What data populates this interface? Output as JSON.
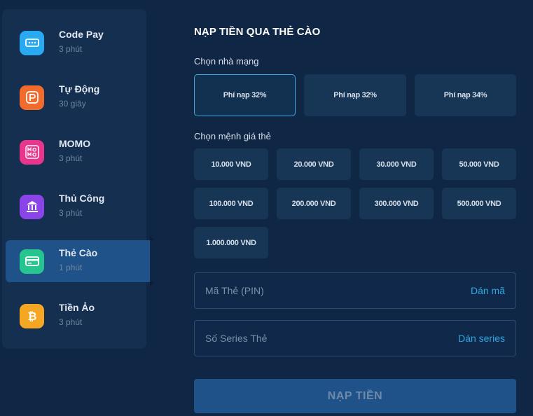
{
  "sidebar": {
    "items": [
      {
        "name": "Code Pay",
        "time": "3 phút",
        "icon": "dots-icon",
        "color": "#29a9f2"
      },
      {
        "name": "Tự Động",
        "time": "30 giây",
        "icon": "p-logo-icon",
        "color": "#f26b2c"
      },
      {
        "name": "MOMO",
        "time": "3 phút",
        "icon": "momo-icon",
        "color": "#e9368c"
      },
      {
        "name": "Thủ Công",
        "time": "3 phút",
        "icon": "bank-icon",
        "color": "#8b44e8"
      },
      {
        "name": "Thẻ Cào",
        "time": "1 phút",
        "icon": "card-icon",
        "color": "#26c48f"
      },
      {
        "name": "Tiền Ảo",
        "time": "3 phút",
        "icon": "bitcoin-icon",
        "color": "#f5a623"
      }
    ],
    "active_index": 4
  },
  "main": {
    "title": "NẠP TIỀN QUA THẺ CÀO",
    "network_label": "Chọn nhà mạng",
    "networks": [
      "Phí nạp 32%",
      "Phí nạp 32%",
      "Phí nạp 34%"
    ],
    "selected_network": 0,
    "amount_label": "Chọn mệnh giá thẻ",
    "amounts": [
      "10.000 VND",
      "20.000 VND",
      "30.000 VND",
      "50.000 VND",
      "100.000 VND",
      "200.000 VND",
      "300.000 VND",
      "500.000 VND",
      "1.000.000 VND"
    ],
    "pin": {
      "placeholder": "Mã Thẻ (PIN)",
      "paste_label": "Dán mã"
    },
    "serial": {
      "placeholder": "Số Series Thẻ",
      "paste_label": "Dán series"
    },
    "submit_label": "NẠP TIỀN"
  },
  "colors": {
    "background": "#0f2744",
    "panel": "#152f50",
    "active": "#1f5288",
    "accent": "#2ea8e0"
  }
}
